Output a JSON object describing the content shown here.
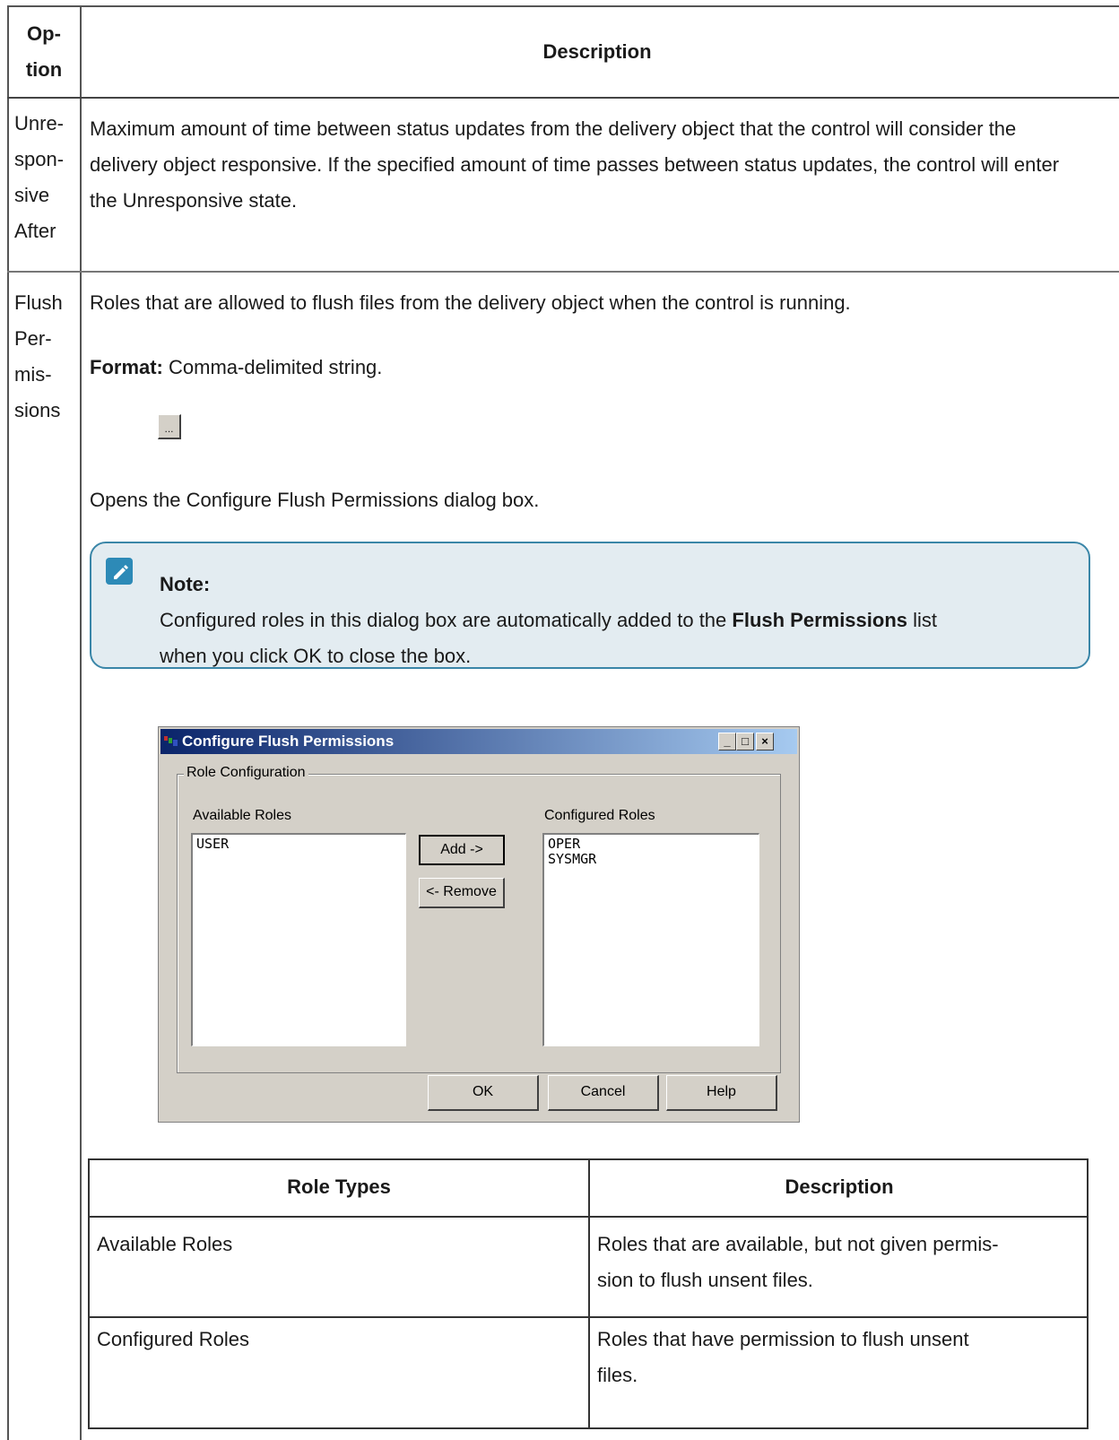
{
  "table": {
    "header_option": "Op-\ntion",
    "header_description": "Description",
    "rows": [
      {
        "option": "Unre-\nspon-\nsive\nAfter",
        "description": "Maximum amount of time between status updates from the delivery object that the control will consider the delivery object responsive. If the specified amount of time passes between status updates, the control will enter the Unresponsive state."
      },
      {
        "option": "Flush\nPer-\nmis-\nsions",
        "description": "Roles that are allowed to flush files from the delivery object when the control is running.",
        "format_label": "Format:",
        "format_value": " Comma-delimited string.",
        "button_label": "...",
        "opens_text": "Opens the Configure Flush Permissions dialog box."
      }
    ]
  },
  "note": {
    "title": "Note:",
    "body_pre": "Configured roles in this dialog box are automatically added to the ",
    "body_bold": "Flush Permissions",
    "body_mid": " list",
    "body_post": "when you click OK to close the box."
  },
  "dialog": {
    "title": "Configure Flush Permissions",
    "group_label": "Role Configuration",
    "available_label": "Available Roles",
    "configured_label": "Configured Roles",
    "available_items": [
      "USER"
    ],
    "configured_items": [
      "OPER",
      "SYSMGR"
    ],
    "add_label": "Add ->",
    "remove_label": "<- Remove",
    "ok_label": "OK",
    "cancel_label": "Cancel",
    "help_label": "Help",
    "minimize": "_",
    "maximize": "□",
    "close": "×"
  },
  "role_table": {
    "headers": [
      "Role Types",
      "Description"
    ],
    "rows": [
      [
        "Available Roles",
        "Roles that are available, but not given permis-\nsion to flush unsent files."
      ],
      [
        "Configured Roles",
        "Roles that have permission to flush unsent\nfiles."
      ]
    ]
  }
}
